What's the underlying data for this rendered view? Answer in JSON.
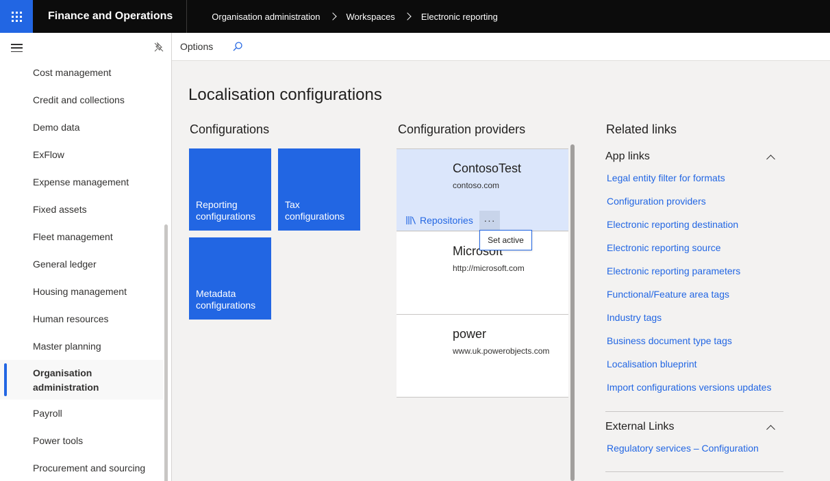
{
  "app": {
    "title": "Finance and Operations"
  },
  "breadcrumb": [
    "Organisation administration",
    "Workspaces",
    "Electronic reporting"
  ],
  "sidebar": {
    "items": [
      {
        "label": "Cost management"
      },
      {
        "label": "Credit and collections"
      },
      {
        "label": "Demo data"
      },
      {
        "label": "ExFlow"
      },
      {
        "label": "Expense management"
      },
      {
        "label": "Fixed assets"
      },
      {
        "label": "Fleet management"
      },
      {
        "label": "General ledger"
      },
      {
        "label": "Housing management"
      },
      {
        "label": "Human resources"
      },
      {
        "label": "Master planning"
      },
      {
        "label": "Organisation administration",
        "active": true
      },
      {
        "label": "Payroll"
      },
      {
        "label": "Power tools"
      },
      {
        "label": "Procurement and sourcing"
      }
    ]
  },
  "actionbar": {
    "options_label": "Options"
  },
  "page": {
    "title": "Localisation configurations"
  },
  "configurations": {
    "heading": "Configurations",
    "tiles": [
      {
        "label": "Reporting configurations"
      },
      {
        "label": "Tax configurations"
      },
      {
        "label": "Metadata configurations"
      }
    ]
  },
  "providers": {
    "heading": "Configuration providers",
    "items": [
      {
        "name": "ContosoTest",
        "url": "contoso.com",
        "active": true
      },
      {
        "name": "Microsoft",
        "url": "http://microsoft.com"
      },
      {
        "name": "power",
        "url": "www.uk.powerobjects.com"
      }
    ],
    "repositories_label": "Repositories",
    "more_label": "···",
    "tooltip": "Set active"
  },
  "related": {
    "heading": "Related links",
    "app_links": {
      "title": "App links",
      "links": [
        "Legal entity filter for formats",
        "Configuration providers",
        "Electronic reporting destination",
        "Electronic reporting source",
        "Electronic reporting parameters",
        "Functional/Feature area tags",
        "Industry tags",
        "Business document type tags",
        "Localisation blueprint",
        "Import configurations versions updates"
      ]
    },
    "external_links": {
      "title": "External Links",
      "links": [
        "Regulatory services – Configuration"
      ]
    }
  },
  "colors": {
    "accent": "#2266e3",
    "topbar": "#0c0c0c",
    "active_card": "#dbe6fb"
  }
}
